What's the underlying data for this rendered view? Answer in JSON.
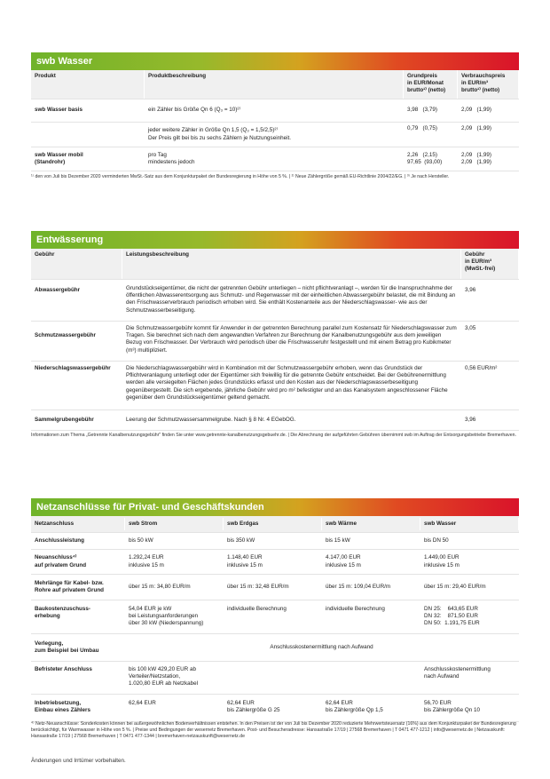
{
  "wasser": {
    "title": "swb Wasser",
    "headers": {
      "produkt": "Produkt",
      "beschreibung": "Produktbeschreibung",
      "grundpreis": "Grundpreis\nin EUR/Monat\nbrutto¹⁾ (netto)",
      "verbrauchspreis": "Verbrauchspreis\nin EUR/m³\nbrutto¹⁾ (netto)"
    },
    "rows": [
      {
        "produkt": "swb Wasser basis",
        "beschreibung": "ein Zähler bis Größe Qn 6 (Q₃ = 10)²⁾",
        "grund": "3,98   (3,79)",
        "verbrauch": "2,09   (1,99)"
      },
      {
        "produkt": "",
        "beschreibung": "jeder weitere Zähler in Größe Qn 1,5 (Q₃ = 1,5/2,5)²⁾\nDer Preis gilt bei bis zu sechs Zählern je Nutzungseinheit.",
        "grund": "0,79   (0,75)",
        "verbrauch": "2,09   (1,99)"
      },
      {
        "produkt": "swb Wasser mobil\n(Standrohr)",
        "beschreibung": "pro Tag\nmindestens jedoch",
        "grund": "2,26   (2,15)\n97,65  (93,00)",
        "verbrauch": "2,09   (1,99)\n2,09   (1,99)"
      }
    ],
    "footnote": "¹⁾ den von Juli bis Dezember 2020 verminderten MwSt.-Satz aus dem Konjunkturpaket der Bundesregierung in Höhe von 5 %. | ²⁾ Neue Zählergröße gemäß EU-Richtlinie 2004/22/EG. | ³⁾ Je nach Hersteller."
  },
  "entwaesserung": {
    "title": "Entwässerung",
    "headers": {
      "gebuehr": "Gebühr",
      "leistung": "Leistungsbeschreibung",
      "preis": "Gebühr\nin EUR/m³\n(MwSt.-frei)"
    },
    "rows": [
      {
        "gebuehr": "Abwassergebühr",
        "text": "Grundstückseigentümer, die nicht der getrennten Gebühr unterliegen – nicht pflichtveranlagt –, werden für die Inanspruchnahme der öffentlichen Abwasserentsorgung aus Schmutz- und Regenwasser mit der einheitlichen Abwassergebühr belastet, die mit Bindung an den Frischwasserverbrauch periodisch erhoben wird. Sie enthält Kostenanteile aus der Niederschlagswasser- wie aus der Schmutzwasserbeseitigung.",
        "preis": "3,96"
      },
      {
        "gebuehr": "Schmutzwassergebühr",
        "text": "Die Schmutzwassergebühr kommt für Anwender in der getrennten Berechnung parallel zum Kostensatz für Niederschlagswasser zum Tragen. Sie berechnet sich nach dem angewandten Verfahren zur Berechnung der Kanalbenutzungsgebühr aus dem jeweiligen Bezug von Frischwasser. Der Verbrauch wird periodisch über die Frischwasseruhr festgestellt und mit einem Betrag pro Kubikmeter (m³) multipliziert.",
        "preis": "3,05"
      },
      {
        "gebuehr": "Niederschlagswassergebühr",
        "text": "Die Niederschlagswassergebühr wird in Kombination mit der Schmutzwassergebühr erhoben, wenn das Grundstück der Pflichtveranlagung unterliegt oder der Eigentümer sich freiwillig für die getrennte Gebühr entscheidet. Bei der Gebührenermittlung werden alle versiegelten Flächen jedes Grundstücks erfasst und den Kosten aus der Niederschlagswasserbeseitigung gegenübergestellt. Die sich ergebende, jährliche Gebühr wird pro m² befestigter und an das Kanalsystem angeschlossener Fläche gegenüber dem Grundstückseigentümer geltend gemacht.",
        "preis": "0,56 EUR/m²"
      },
      {
        "gebuehr": "Sammelgrubengebühr",
        "text": "Leerung der Schmutzwassersammelgrube. Nach § 8 Nr. 4 EGebOG.",
        "preis": "3,96"
      }
    ],
    "footnote": "Informationen zum Thema „Getrennte Kanalbenutzungsgebühr\" finden Sie unter www.getrennte-kanalbenutzungsgebuehr.de. | Die Abrechnung der aufgeführten Gebühren übernimmt swb im Auftrag der Entsorgungsbetriebe Bremerhaven."
  },
  "netz": {
    "title": "Netzanschlüsse für Privat- und Geschäftskunden",
    "headers": [
      "Netzanschluss",
      "swb Strom",
      "swb Erdgas",
      "swb Wärme",
      "swb Wasser"
    ],
    "rows": [
      {
        "label": "Anschlussleistung",
        "c": [
          "bis 50 kW",
          "bis 350 kW",
          "bis 15 kW",
          "bis DN 50"
        ]
      },
      {
        "label": "Neuanschluss⁴⁾\nauf privatem Grund",
        "c": [
          "1.292,24 EUR\ninklusive 15 m",
          "1.148,40 EUR\ninklusive 15 m",
          "4.147,00 EUR\ninklusive 15 m",
          "1.449,00 EUR\ninklusive 15 m"
        ]
      },
      {
        "label": "Mehrlänge für Kabel- bzw.\nRohre auf privatem Grund",
        "c": [
          "über 15 m: 34,80 EUR/m",
          "über 15 m: 32,48 EUR/m",
          "über 15 m: 109,04 EUR/m",
          "über 15 m: 29,40 EUR/m"
        ]
      },
      {
        "label": "Baukostenzuschuss-\nerhebung",
        "c": [
          "54,04 EUR je kW\nbei Leistungsanforderungen\nüber 30 kW (Niederspannung)",
          "individuelle Berechnung",
          "individuelle Berechnung",
          "DN 25:    643,65 EUR\nDN 32:    871,50 EUR\nDN 50:  1.191,75 EUR"
        ]
      },
      {
        "label": "Verlegung,\nzum Beispiel bei Umbau",
        "span": "Anschlusskostenermittlung nach Aufwand"
      },
      {
        "label": "Befristeter Anschluss",
        "c": [
          "bis 100 kW 429,20 EUR ab\nVerteiler/Netzstation,\n1.020,80 EUR ab Netzkabel",
          "",
          "",
          "Anschlusskostenermittlung\nnach Aufwand"
        ]
      },
      {
        "label": "Inbetriebsetzung,\nEinbau eines Zählers",
        "c": [
          "62,64 EUR",
          "62,64 EUR\nbis Zählergröße G 25",
          "62,64 EUR\nbis Zählergröße Qp 1,5",
          "56,70 EUR\nbis Zählergröße Qn 10"
        ]
      }
    ],
    "footnote": "⁴⁾ Netz-Neuanschlüsse: Sonderkosten können bei außergewöhnlichen Bodenverhältnissen entstehen. In den Preisen ist der von Juli bis Dezember 2020 reduzierte Mehrwertsteuersatz (16%) aus dem Konjunkturpaket der Bundesregierung berücksichtigt, für Warmwasser in Höhe von 5 %. | Preise und Bedingungen der wesernetz Bremerhaven. Post- und Besucheradresse: Hansastraße 17/19 | 27568 Bremerhaven | T 0471 477-1212 | info@wesernetz.de | Netzauskunft: Hansastraße 17/19 | 27568 Bremerhaven | T 0471 477-1344 | bremerhaven-netzauskunft@wesernetz.de"
  },
  "closing": "Änderungen und Irrtümer vorbehalten."
}
